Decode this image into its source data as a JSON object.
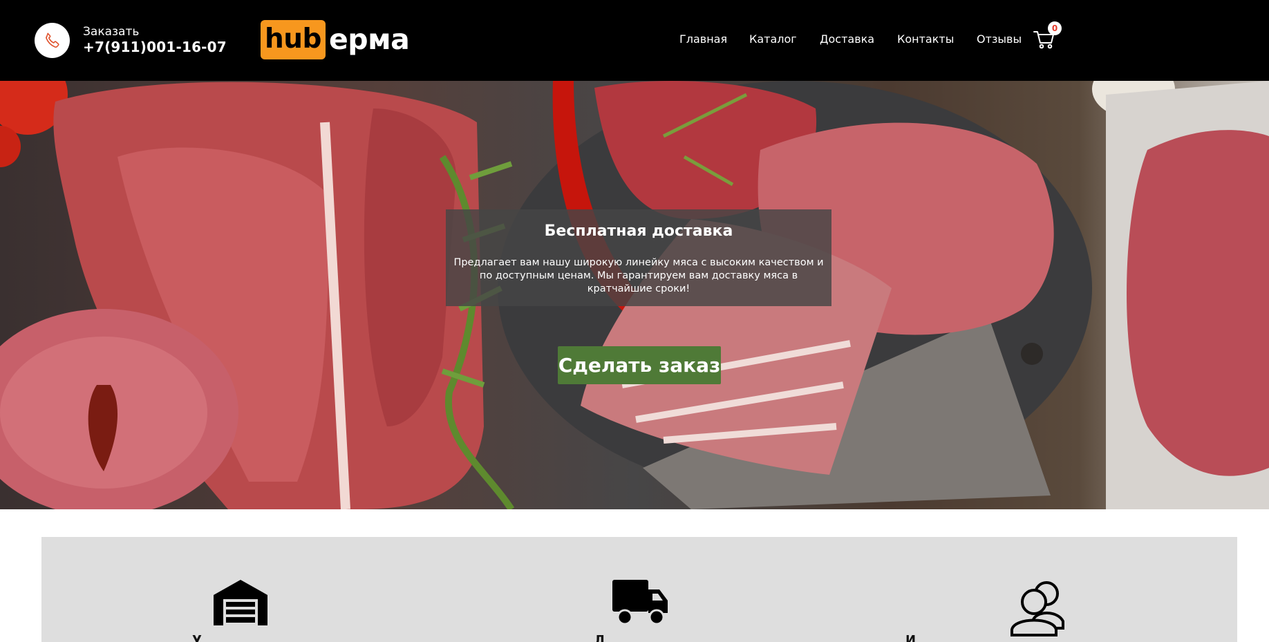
{
  "header": {
    "order_label": "Заказать",
    "phone": "+7(911)001-16-07",
    "logo_part1": "hub",
    "logo_part2": "ерма",
    "nav": [
      "Главная",
      "Каталог",
      "Доставка",
      "Контакты",
      "Отзывы"
    ],
    "cart_count": "0"
  },
  "hero": {
    "title": "Бесплатная доставка",
    "text": "Предлагает вам нашу широкую линейку мяса с высоким качеством и по доступным ценам. Мы гарантируем вам доставку мяса в кратчайшие сроки!",
    "cta": "Сделать заказ"
  },
  "features": {
    "items": [
      {
        "icon": "warehouse-icon"
      },
      {
        "icon": "truck-icon"
      },
      {
        "icon": "users-icon"
      }
    ]
  },
  "colors": {
    "header_bg": "#000000",
    "logo_accent": "#f7971e",
    "cta_bg": "#4f7a37",
    "features_bg": "#dedede",
    "badge_text": "#e53b2c"
  }
}
